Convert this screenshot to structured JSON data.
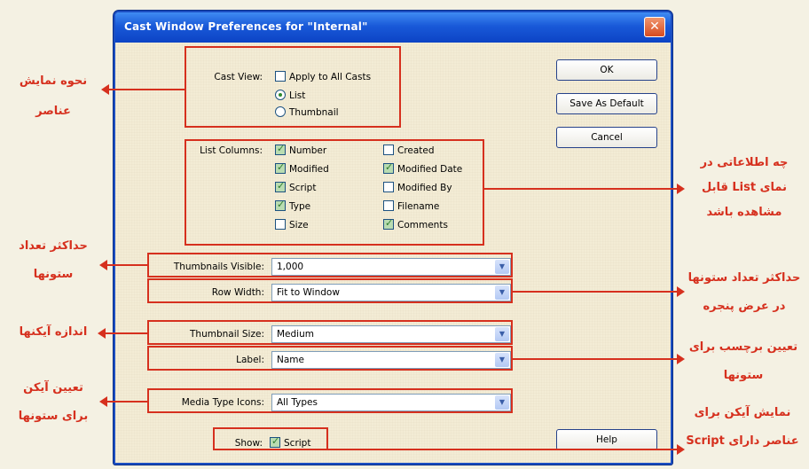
{
  "dialog": {
    "title": "Cast Window Preferences for \"Internal\"",
    "close_glyph": "✕"
  },
  "cast_view": {
    "label": "Cast View:",
    "apply_all": {
      "label": "Apply to All Casts",
      "checked": false
    },
    "options": [
      {
        "label": "List",
        "selected": true
      },
      {
        "label": "Thumbnail",
        "selected": false
      }
    ]
  },
  "list_columns": {
    "label": "List Columns:",
    "left": [
      {
        "label": "Number",
        "checked": true
      },
      {
        "label": "Modified",
        "checked": true
      },
      {
        "label": "Script",
        "checked": true
      },
      {
        "label": "Type",
        "checked": true
      },
      {
        "label": "Size",
        "checked": false
      }
    ],
    "right": [
      {
        "label": "Created",
        "checked": false
      },
      {
        "label": "Modified Date",
        "checked": true
      },
      {
        "label": "Modified By",
        "checked": false
      },
      {
        "label": "Filename",
        "checked": false
      },
      {
        "label": "Comments",
        "checked": true
      }
    ]
  },
  "fields": {
    "thumbnails_visible": {
      "label": "Thumbnails Visible:",
      "value": "1,000"
    },
    "row_width": {
      "label": "Row Width:",
      "value": "Fit to Window"
    },
    "thumbnail_size": {
      "label": "Thumbnail Size:",
      "value": "Medium"
    },
    "label": {
      "label": "Label:",
      "value": "Name"
    },
    "media_type_icons": {
      "label": "Media Type Icons:",
      "value": "All Types"
    }
  },
  "show": {
    "label": "Show:",
    "script": {
      "label": "Script",
      "checked": true
    }
  },
  "buttons": {
    "ok": "OK",
    "save_default": "Save As Default",
    "cancel": "Cancel",
    "help": "Help"
  },
  "annotations": {
    "cast_view_l1": "نحوه نمایش",
    "cast_view_l2": "عناصر",
    "list_l1": "چه اطلاعاتی در",
    "list_l2": "نمای List قابل",
    "list_l3": "مشاهده باشد",
    "thumb_l1": "حداکثر تعداد",
    "thumb_l2": "ستونها",
    "row_l1": "حداکثر تعداد ستونها",
    "row_l2": "در عرض پنجره",
    "size_l1": "اندازه آیکنها",
    "label_l1": "تعیین برچسب برای",
    "label_l2": "ستونها",
    "media_l1": "تعیین آیکن",
    "media_l2": "برای ستونها",
    "show_l1": "نمایش آیکن برای",
    "show_l2": "عناصر دارای Script"
  },
  "colors": {
    "annotation_red": "#d6301e",
    "titlebar_blue": "#1959d8"
  }
}
